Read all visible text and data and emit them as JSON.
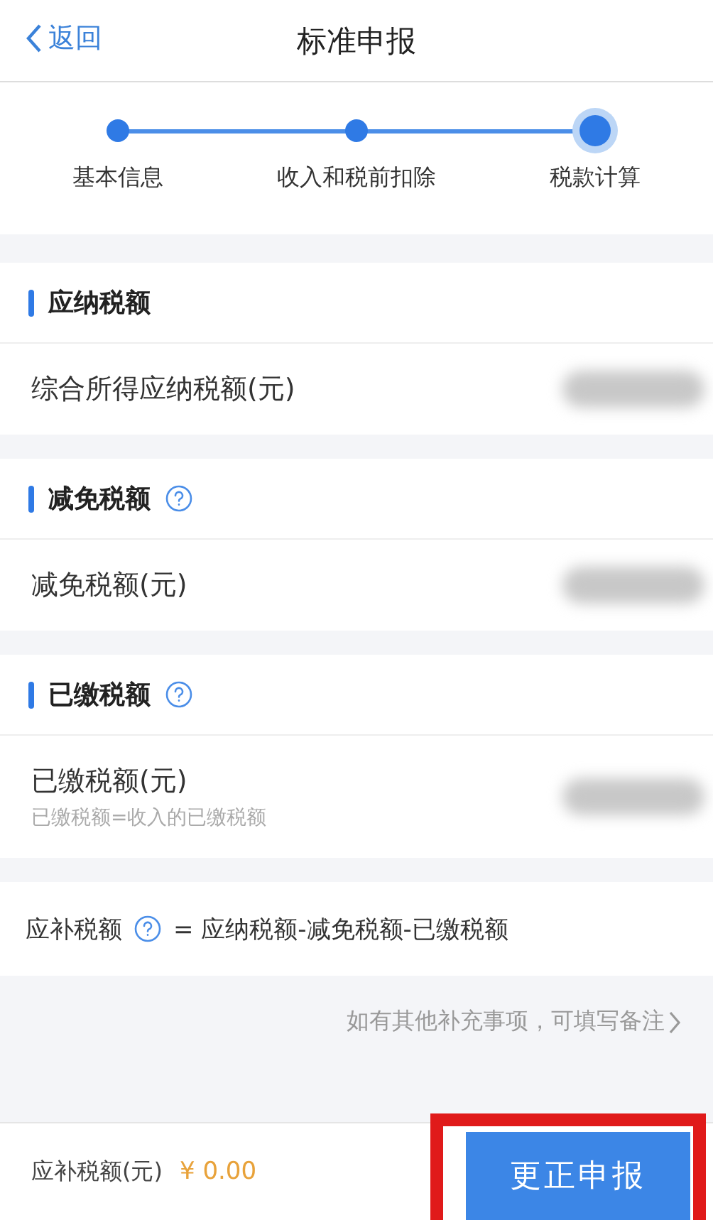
{
  "header": {
    "back": "返回",
    "title": "标准申报"
  },
  "steps": [
    {
      "label": "基本信息",
      "selected": false
    },
    {
      "label": "收入和税前扣除",
      "selected": false
    },
    {
      "label": "税款计算",
      "selected": true
    }
  ],
  "sections": [
    {
      "title": "应纳税额",
      "has_help": false,
      "rows": [
        {
          "label": "综合所得应纳税额(元)"
        }
      ]
    },
    {
      "title": "减免税额",
      "has_help": true,
      "rows": [
        {
          "label": "减免税额(元)"
        }
      ]
    },
    {
      "title": "已缴税额",
      "has_help": true,
      "rows": [
        {
          "label": "已缴税额(元)",
          "hint": "已缴税额=收入的已缴税额"
        }
      ]
    }
  ],
  "formula": {
    "label": "应补税额",
    "formula": "= 应纳税额-减免税额-已缴税额"
  },
  "remark_link": "如有其他补充事项，可填写备注",
  "footer": {
    "label": "应补税额(元)",
    "amount": "¥ 0.00",
    "button": "更正申报",
    "highlighted": true
  }
}
